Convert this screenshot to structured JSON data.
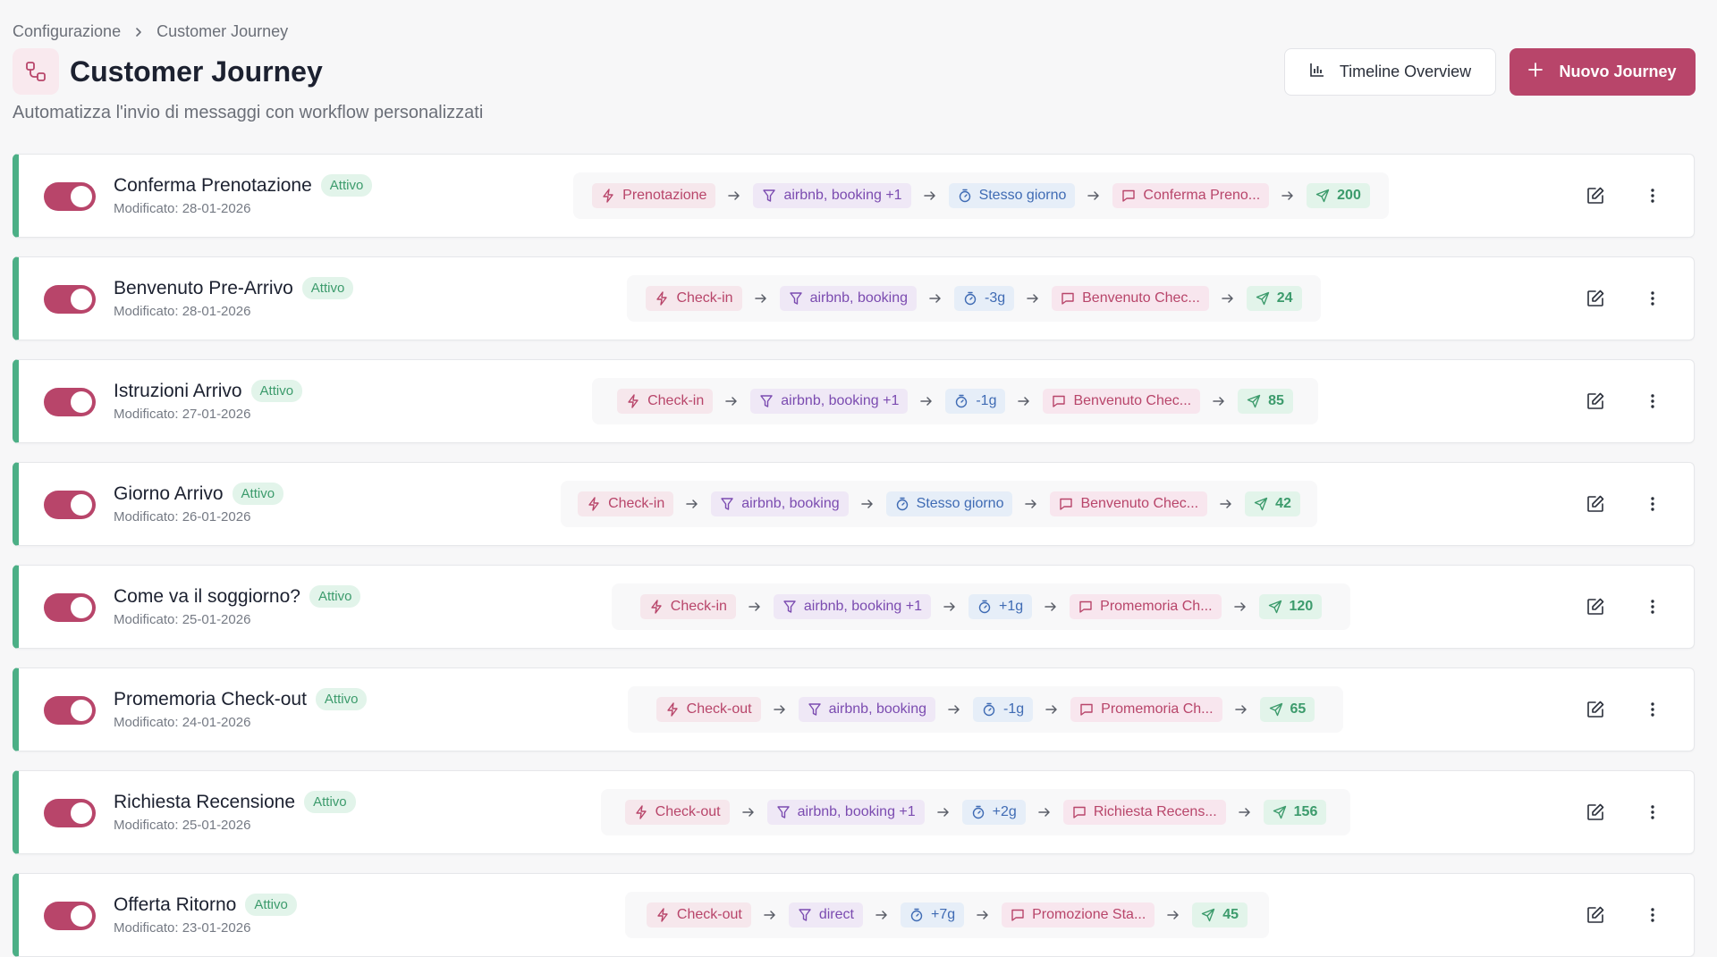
{
  "breadcrumb": {
    "parent": "Configurazione",
    "current": "Customer Journey"
  },
  "header": {
    "title": "Customer Journey",
    "subtitle": "Automatizza l'invio di messaggi con workflow personalizzati",
    "timeline_label": "Timeline Overview",
    "new_label": "Nuovo Journey"
  },
  "colors": {
    "accent": "#b8456a",
    "active_green": "#4caf86",
    "status_bg": "#e2f4ea"
  },
  "icons": {
    "trigger": "bolt-icon",
    "filter": "funnel-icon",
    "timer": "stopwatch-icon",
    "message": "message-icon",
    "sent": "send-icon",
    "edit": "edit-icon",
    "more": "more-vertical-icon"
  },
  "journeys": [
    {
      "name": "Conferma Prenotazione",
      "status": "Attivo",
      "modified": "Modificato: 28-01-2026",
      "enabled": true,
      "trigger": "Prenotazione",
      "filter": "airbnb, booking +1",
      "timing": "Stesso giorno",
      "message": "Conferma Preno...",
      "sent": "200"
    },
    {
      "name": "Benvenuto Pre-Arrivo",
      "status": "Attivo",
      "modified": "Modificato: 28-01-2026",
      "enabled": true,
      "trigger": "Check-in",
      "filter": "airbnb, booking",
      "timing": "-3g",
      "message": "Benvenuto Chec...",
      "sent": "24"
    },
    {
      "name": "Istruzioni Arrivo",
      "status": "Attivo",
      "modified": "Modificato: 27-01-2026",
      "enabled": true,
      "trigger": "Check-in",
      "filter": "airbnb, booking +1",
      "timing": "-1g",
      "message": "Benvenuto Chec...",
      "sent": "85"
    },
    {
      "name": "Giorno Arrivo",
      "status": "Attivo",
      "modified": "Modificato: 26-01-2026",
      "enabled": true,
      "trigger": "Check-in",
      "filter": "airbnb, booking",
      "timing": "Stesso giorno",
      "message": "Benvenuto Chec...",
      "sent": "42"
    },
    {
      "name": "Come va il soggiorno?",
      "status": "Attivo",
      "modified": "Modificato: 25-01-2026",
      "enabled": true,
      "trigger": "Check-in",
      "filter": "airbnb, booking +1",
      "timing": "+1g",
      "message": "Promemoria Ch...",
      "sent": "120"
    },
    {
      "name": "Promemoria Check-out",
      "status": "Attivo",
      "modified": "Modificato: 24-01-2026",
      "enabled": true,
      "trigger": "Check-out",
      "filter": "airbnb, booking",
      "timing": "-1g",
      "message": "Promemoria Ch...",
      "sent": "65"
    },
    {
      "name": "Richiesta Recensione",
      "status": "Attivo",
      "modified": "Modificato: 25-01-2026",
      "enabled": true,
      "trigger": "Check-out",
      "filter": "airbnb, booking +1",
      "timing": "+2g",
      "message": "Richiesta Recens...",
      "sent": "156"
    },
    {
      "name": "Offerta Ritorno",
      "status": "Attivo",
      "modified": "Modificato: 23-01-2026",
      "enabled": true,
      "trigger": "Check-out",
      "filter": "direct",
      "timing": "+7g",
      "message": "Promozione Sta...",
      "sent": "45"
    }
  ]
}
